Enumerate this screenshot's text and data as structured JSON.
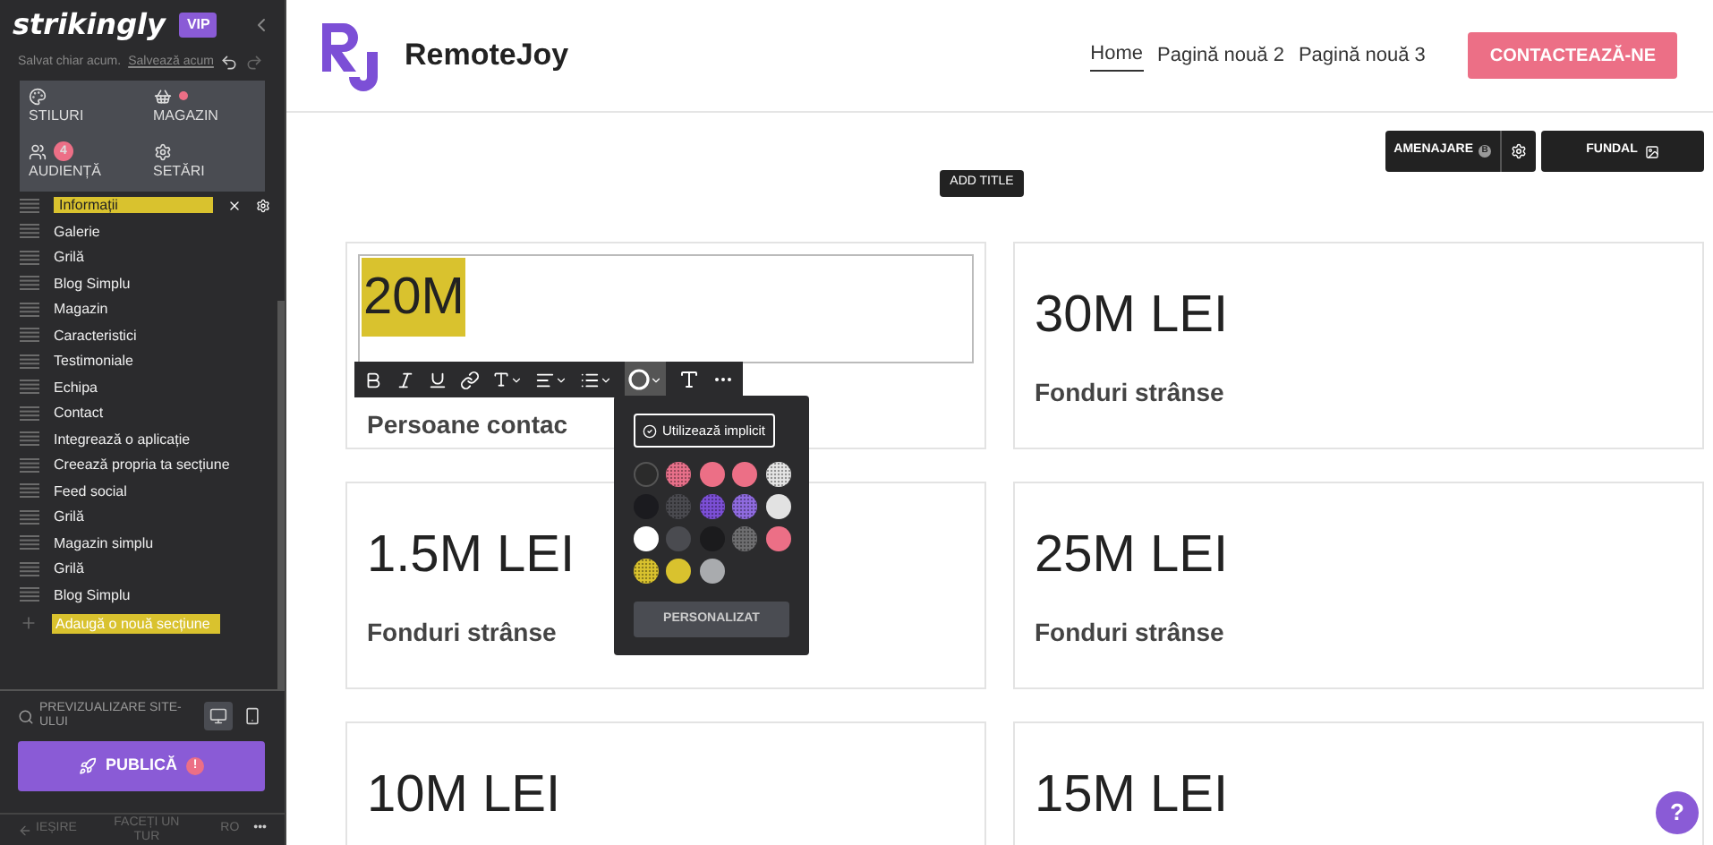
{
  "sidebar": {
    "brand": "strikingly",
    "badge": "VIP",
    "saved": "Salvat chiar acum.",
    "save_link": "Salvează acum",
    "panel": [
      {
        "kind": "styles",
        "label": "STILURI"
      },
      {
        "kind": "store",
        "label": "MAGAZIN",
        "dot": true
      },
      {
        "kind": "audience",
        "label": "AUDIENȚĂ",
        "count": "4"
      },
      {
        "kind": "settings",
        "label": "SETĂRI"
      }
    ],
    "sections": [
      {
        "label": "Informații",
        "selected": true
      },
      {
        "label": "Galerie",
        "selected": false
      },
      {
        "label": "Grilă",
        "selected": false
      },
      {
        "label": "Blog Simplu",
        "selected": false
      },
      {
        "label": "Magazin",
        "selected": false
      },
      {
        "label": "Caracteristici",
        "selected": false
      },
      {
        "label": "Testimoniale",
        "selected": false
      },
      {
        "label": "Echipa",
        "selected": false
      },
      {
        "label": "Contact",
        "selected": false
      },
      {
        "label": "Integrează o aplicație",
        "selected": false
      },
      {
        "label": "Creează propria ta secțiune",
        "selected": false
      },
      {
        "label": "Feed social",
        "selected": false
      },
      {
        "label": "Grilă",
        "selected": false
      },
      {
        "label": "Magazin simplu",
        "selected": false
      },
      {
        "label": "Grilă",
        "selected": false
      },
      {
        "label": "Blog Simplu",
        "selected": false
      }
    ],
    "add_section": "Adaugă o nouă secțiune",
    "preview": "PREVIZUALIZARE SITE-ULUI",
    "devices": [
      {
        "kind": "desktop",
        "selected": true
      },
      {
        "kind": "mobile",
        "selected": false
      }
    ],
    "publish": "PUBLICĂ",
    "publish_alert": "!",
    "footer": {
      "exit": "IEȘIRE",
      "tour": "FACEȚI UN TUR",
      "language": "RO",
      "more": "•••"
    }
  },
  "site": {
    "name": "RemoteJoy",
    "nav": [
      {
        "label": "Home",
        "selected": true
      },
      {
        "label": "Pagină nouă 2",
        "selected": false
      },
      {
        "label": "Pagină nouă 3",
        "selected": false
      }
    ],
    "cta": "CONTACTEAZĂ-NE"
  },
  "section_tools": {
    "layout": "AMENAJARE",
    "layout_badge": "B",
    "background": "FUNDAL",
    "add_title": "ADD TITLE"
  },
  "cards": [
    {
      "value": "20M",
      "label": "Persoane contac",
      "editing": true
    },
    {
      "value": "30M LEI",
      "label": "Fonduri strânse",
      "editing": false
    },
    {
      "value": "1.5M LEI",
      "label": "Fonduri strânse",
      "editing": false
    },
    {
      "value": "25M LEI",
      "label": "Fonduri strânse",
      "editing": false
    },
    {
      "value": "10M LEI",
      "editing": false
    },
    {
      "value": "15M LEI",
      "editing": false
    }
  ],
  "color_menu": {
    "default_button": "Utilizează implicit",
    "custom_button": "PERSONALIZAT",
    "swatches": [
      {
        "kind": "outline",
        "color": "#2b2b2b"
      },
      {
        "kind": "pattern",
        "color": "#e8708a"
      },
      {
        "kind": "solid",
        "color": "#ec6f86"
      },
      {
        "kind": "solid",
        "color": "#ec6f86"
      },
      {
        "kind": "pattern",
        "color": "#e4e4e4"
      },
      {
        "kind": "solid",
        "color": "#1b1b1f"
      },
      {
        "kind": "pattern",
        "color": "#4a4a4f"
      },
      {
        "kind": "pattern",
        "color": "#7c4fd6"
      },
      {
        "kind": "pattern",
        "color": "#8f6be0"
      },
      {
        "kind": "solid",
        "color": "#e2e2e2"
      },
      {
        "kind": "solid",
        "color": "#ffffff"
      },
      {
        "kind": "solid",
        "color": "#4a4b50"
      },
      {
        "kind": "solid",
        "color": "#1b1b1d"
      },
      {
        "kind": "pattern",
        "color": "#6e6e70"
      },
      {
        "kind": "solid",
        "color": "#ec6f86"
      },
      {
        "kind": "pattern",
        "color": "#d9c22e"
      },
      {
        "kind": "solid",
        "color": "#d9c22e"
      },
      {
        "kind": "solid",
        "color": "#a9abae"
      }
    ]
  },
  "help": "?"
}
